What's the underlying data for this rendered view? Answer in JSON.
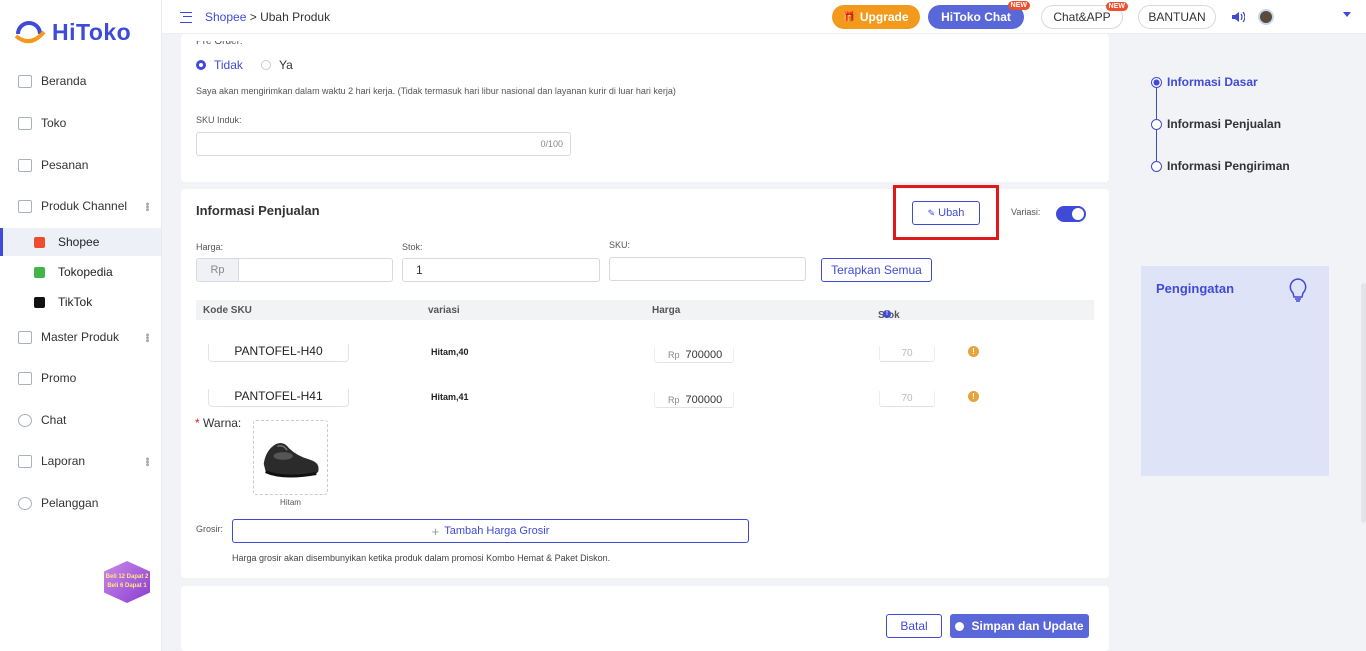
{
  "app": {
    "name": "HiToko"
  },
  "sidebar": {
    "items": [
      {
        "label": "Beranda"
      },
      {
        "label": "Toko"
      },
      {
        "label": "Pesanan"
      },
      {
        "label": "Produk Channel"
      },
      {
        "label": "Master Produk"
      },
      {
        "label": "Promo"
      },
      {
        "label": "Chat"
      },
      {
        "label": "Laporan"
      },
      {
        "label": "Pelanggan"
      }
    ],
    "channels": [
      {
        "label": "Shopee",
        "color": "#ee4d2d"
      },
      {
        "label": "Tokopedia",
        "color": "#42b549"
      },
      {
        "label": "TikTok",
        "color": "#111111"
      }
    ],
    "promo_badge": {
      "line1": "Beli 12 Dapat 2",
      "line2": "Beli 6 Dapat 1"
    }
  },
  "topbar": {
    "breadcrumb_shop": "Shopee",
    "breadcrumb_sep": " > ",
    "breadcrumb_page": "Ubah Produk",
    "upgrade": "Upgrade",
    "hitoko_chat": "HiToko Chat",
    "chat_app": "Chat&APP",
    "bantuan": "BANTUAN",
    "new_tag": "NEW"
  },
  "basic": {
    "preorder_label": "Pre Order:",
    "radio_no": "Tidak",
    "radio_yes": "Ya",
    "shipping_note": "Saya akan mengirimkan dalam waktu 2 hari kerja. (Tidak termasuk hari libur nasional dan layanan kurir di luar hari kerja)",
    "sku_label": "SKU Induk:",
    "sku_value": "",
    "sku_counter": "0/100"
  },
  "sales": {
    "title": "Informasi Penjualan",
    "edit_button": "Ubah",
    "variation_label": "Variasi:",
    "price_label": "Harga:",
    "price_prefix": "Rp",
    "stock_label": "Stok:",
    "stock_value": "1",
    "sku_label": "SKU:",
    "apply_all": "Terapkan Semua",
    "columns": [
      "Kode SKU",
      "variasi",
      "Harga",
      "Stok"
    ],
    "rows": [
      {
        "sku": "PANTOFEL-H40",
        "variation": "Hitam,40",
        "price_prefix": "Rp",
        "price": "700000",
        "stock": "70"
      },
      {
        "sku": "PANTOFEL-H41",
        "variation": "Hitam,41",
        "price_prefix": "Rp",
        "price": "700000",
        "stock": "70"
      }
    ],
    "color_required": "*",
    "color_label": "Warna:",
    "color_caption": "Hitam",
    "wholesale_label": "Grosir:",
    "wholesale_button": "Tambah Harga Grosir",
    "wholesale_note": "Harga grosir akan disembunyikan ketika produk dalam promosi Kombo Hemat & Paket Diskon."
  },
  "footer": {
    "cancel": "Batal",
    "save": "Simpan dan Update"
  },
  "steps": [
    {
      "label": "Informasi Dasar",
      "active": true
    },
    {
      "label": "Informasi Penjualan",
      "active": false
    },
    {
      "label": "Informasi Pengiriman",
      "active": false
    }
  ],
  "reminder": {
    "title": "Pengingatan"
  },
  "colors": {
    "accent": "#3f4bd6",
    "upgrade": "#f39a1d",
    "highlight": "#e01a1a",
    "warning": "#e6a23c"
  }
}
